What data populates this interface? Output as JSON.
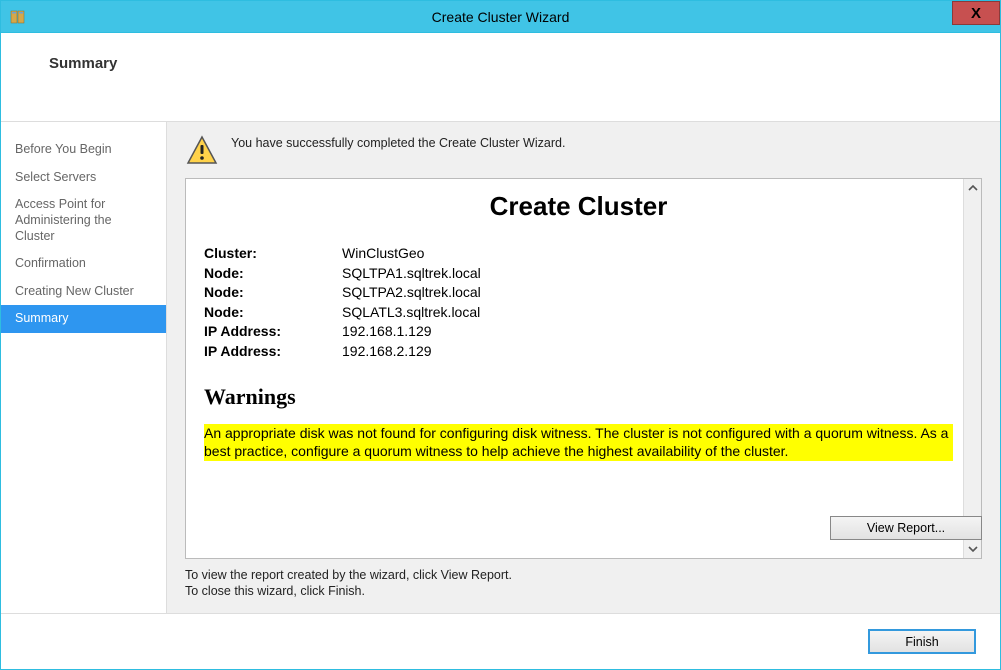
{
  "window": {
    "title": "Create Cluster Wizard"
  },
  "header": {
    "title": "Summary"
  },
  "sidebar": {
    "items": [
      {
        "label": "Before You Begin"
      },
      {
        "label": "Select Servers"
      },
      {
        "label": "Access Point for Administering the Cluster"
      },
      {
        "label": "Confirmation"
      },
      {
        "label": "Creating New Cluster"
      },
      {
        "label": "Summary"
      }
    ]
  },
  "main": {
    "completion_message": "You have successfully completed the Create Cluster Wizard.",
    "report": {
      "title": "Create Cluster",
      "rows": [
        {
          "label": "Cluster:",
          "value": "WinClustGeo"
        },
        {
          "label": "Node:",
          "value": "SQLTPA1.sqltrek.local"
        },
        {
          "label": "Node:",
          "value": "SQLTPA2.sqltrek.local"
        },
        {
          "label": "Node:",
          "value": "SQLATL3.sqltrek.local"
        },
        {
          "label": "IP Address:",
          "value": "192.168.1.129"
        },
        {
          "label": "IP Address:",
          "value": "192.168.2.129"
        }
      ],
      "warnings_heading": "Warnings",
      "warning_text": "An appropriate disk was not found for configuring disk witness. The cluster is not configured with a quorum witness. As a best practice, configure a quorum witness to help achieve the highest availability of the cluster."
    },
    "hint_line1": "To view the report created by the wizard, click View Report.",
    "hint_line2": "To close this wizard, click Finish.",
    "view_report_label": "View Report...",
    "finish_label": "Finish"
  }
}
